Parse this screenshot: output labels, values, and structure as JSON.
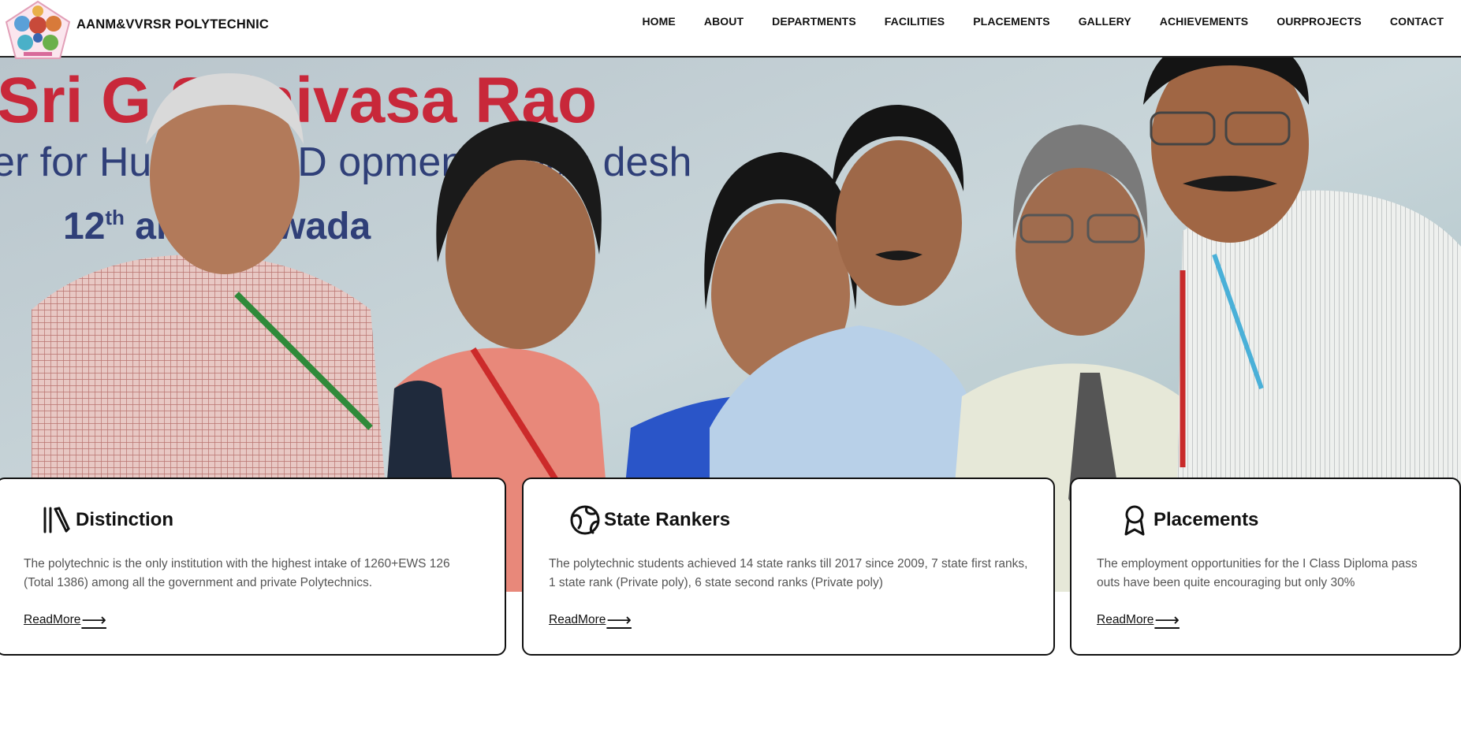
{
  "header": {
    "brand": "AANM&VVRSR POLYTECHNIC",
    "nav": [
      "HOME",
      "ABOUT",
      "DEPARTMENTS",
      "FACILITIES",
      "PLACEMENTS",
      "GALLERY",
      "ACHIEVEMENTS",
      "OURPROJECTS",
      "CONTACT"
    ]
  },
  "hero": {
    "banner_line1": "Sri G   Srinivasa Rao",
    "banner_line2": "er for Hu    source D   opment, Andh   desh",
    "banner_line3_a": "12",
    "banner_line3_sup": "th",
    "banner_line3_b": "       ary 201      wada"
  },
  "cards": [
    {
      "icon": "books-icon",
      "title": "Distinction",
      "text": "The polytechnic is the only institution with the highest intake of 1260+EWS 126 (Total 1386) among all the government and private Polytechnics.",
      "link": "ReadMore"
    },
    {
      "icon": "globe-icon",
      "title": "State Rankers",
      "text": "The polytechnic students achieved 14 state ranks till 2017 since 2009, 7 state first ranks, 1 state rank (Private poly), 6 state second ranks (Private poly)",
      "link": "ReadMore"
    },
    {
      "icon": "award-icon",
      "title": "Placements",
      "text": "The employment opportunities for the I Class Diploma pass outs have been quite encouraging but only 30%",
      "link": "ReadMore"
    }
  ],
  "colors": {
    "banner_red": "#c8283a",
    "banner_blue": "#2f3f78",
    "text_gray": "#555555"
  }
}
